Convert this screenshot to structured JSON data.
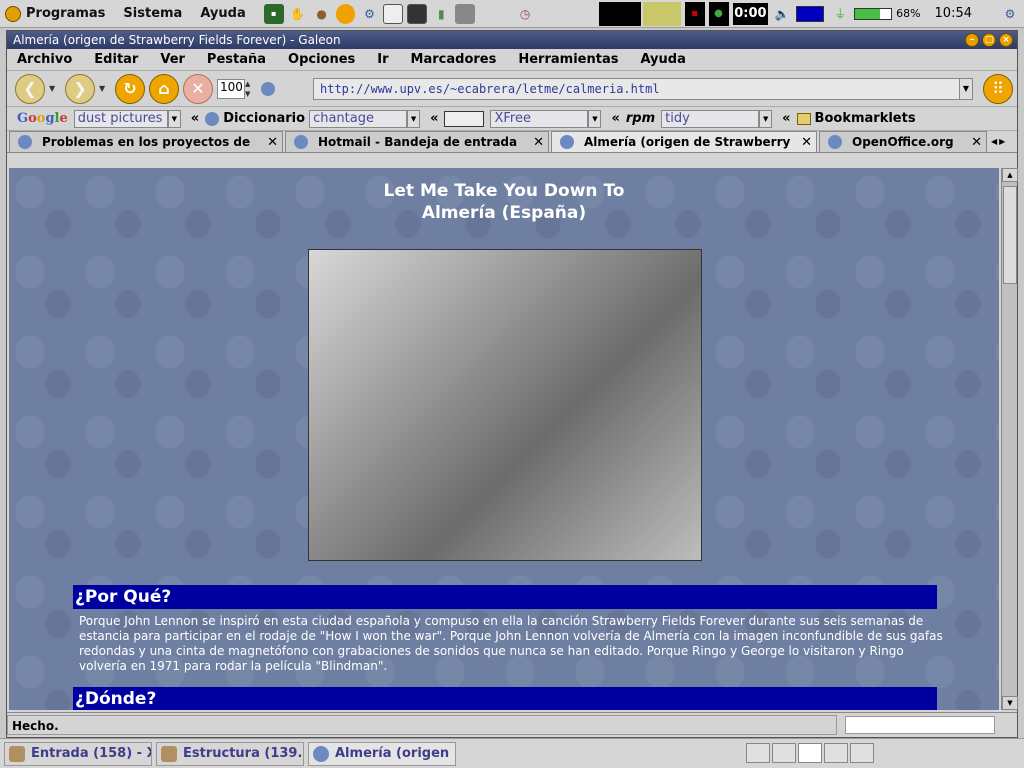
{
  "top_panel": {
    "menus": [
      "Programas",
      "Sistema",
      "Ayuda"
    ],
    "clock": "10:54",
    "battery_text": "68%",
    "battery_level": 68,
    "timer": "0:00"
  },
  "window": {
    "title": "Almería (origen de Strawberry Fields Forever) - Galeon"
  },
  "menubar": [
    "Archivo",
    "Editar",
    "Ver",
    "Pestaña",
    "Opciones",
    "Ir",
    "Marcadores",
    "Herramientas",
    "Ayuda"
  ],
  "navbar": {
    "zoom": "100",
    "url": "http://www.upv.es/~ecabrera/letme/calmeria.html"
  },
  "toolbar2": {
    "google_label": "Google",
    "google_query": "dust pictures",
    "diccionario_label": "Diccionario",
    "diccionario_query": "chantage",
    "xfree_query": "XFree",
    "rpm_label": "rpm",
    "rpm_query": "tidy",
    "bookmarklets_label": "Bookmarklets"
  },
  "tabs": [
    {
      "label": "Problemas en los proyectos de"
    },
    {
      "label": "Hotmail - Bandeja de entrada"
    },
    {
      "label": "Almería (origen de Strawberry"
    },
    {
      "label": "OpenOffice.org"
    }
  ],
  "page": {
    "title_line1": "Let Me Take You Down To",
    "title_line2": "Almería (España)",
    "section1_heading": "¿Por Qué?",
    "section1_text": "Porque John Lennon se inspiró en esta ciudad española y compuso en ella la canción Strawberry Fields Forever durante sus seis semanas de estancia para participar en el rodaje de \"How I won the war\". Porque John Lennon volvería de Almería con la imagen inconfundible de sus gafas redondas y una cinta de magnetófono con grabaciones de sonidos que nunca se han editado. Porque Ringo y George lo visitaron y Ringo volvería en 1971 para rodar la película \"Blindman\".",
    "section2_heading": "¿Dónde?"
  },
  "status": {
    "text": "Hecho."
  },
  "taskbar": [
    {
      "label": "Entrada (158) - X..."
    },
    {
      "label": "Estructura (139..."
    },
    {
      "label": "Almería (origen ..."
    }
  ]
}
